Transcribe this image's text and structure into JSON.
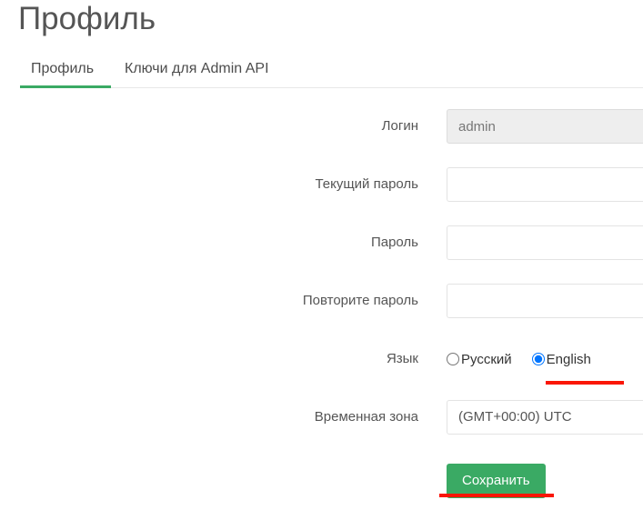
{
  "page": {
    "title": "Профиль"
  },
  "tabs": [
    {
      "label": "Профиль",
      "active": true
    },
    {
      "label": "Ключи для Admin API",
      "active": false
    }
  ],
  "form": {
    "rows": [
      {
        "label": "Логин",
        "type": "text",
        "value": "admin",
        "placeholder": "",
        "disabled": true
      },
      {
        "label": "Текущий пароль",
        "type": "password",
        "value": "",
        "placeholder": "",
        "disabled": false
      },
      {
        "label": "Пароль",
        "type": "password",
        "value": "",
        "placeholder": "",
        "disabled": false
      },
      {
        "label": "Повторите пароль",
        "type": "password",
        "value": "",
        "placeholder": "",
        "disabled": false
      }
    ],
    "language": {
      "label": "Язык",
      "options": [
        {
          "label": "Русский",
          "selected": false
        },
        {
          "label": "English",
          "selected": true
        }
      ]
    },
    "timezone": {
      "label": "Временная зона",
      "value": "(GMT+00:00) UTC"
    },
    "save_label": "Сохранить"
  },
  "colors": {
    "accent_green": "#3aaa64",
    "annotation_red": "#fa1606",
    "label_text": "#555555",
    "disabled_field_bg": "#eeeeee"
  }
}
